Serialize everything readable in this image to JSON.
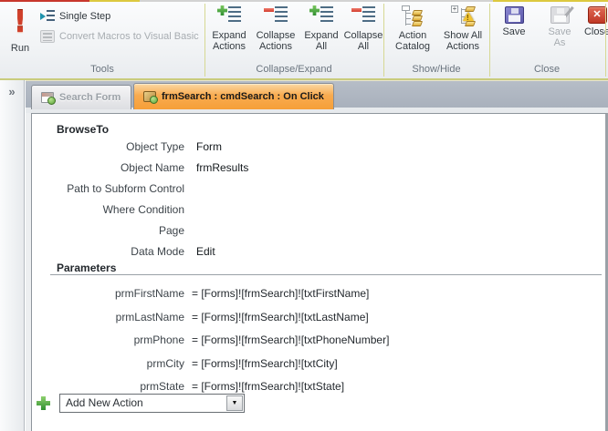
{
  "ribbon": {
    "groups": [
      {
        "label": "Tools",
        "buttons": [
          {
            "label": "Run"
          },
          {
            "label": "Single Step"
          },
          {
            "label": "Convert Macros to Visual Basic"
          }
        ]
      },
      {
        "label": "Collapse/Expand",
        "buttons": [
          {
            "label": "Expand Actions"
          },
          {
            "label": "Collapse Actions"
          },
          {
            "label": "Expand All"
          },
          {
            "label": "Collapse All"
          }
        ]
      },
      {
        "label": "Show/Hide",
        "buttons": [
          {
            "label": "Action Catalog"
          },
          {
            "label": "Show All Actions"
          }
        ]
      },
      {
        "label": "Close",
        "buttons": [
          {
            "label": "Save"
          },
          {
            "label": "Save As"
          },
          {
            "label": "Close"
          }
        ]
      }
    ]
  },
  "nav_pane": {
    "expand_chevron": "»"
  },
  "tabs": [
    {
      "label": "Search Form",
      "active": false
    },
    {
      "label": "frmSearch : cmdSearch : On Click",
      "active": true
    }
  ],
  "macro": {
    "action": "BrowseTo",
    "fields": [
      {
        "label": "Object Type",
        "value": "Form"
      },
      {
        "label": "Object Name",
        "value": "frmResults"
      },
      {
        "label": "Path to Subform Control",
        "value": ""
      },
      {
        "label": "Where Condition",
        "value": ""
      },
      {
        "label": "Page",
        "value": ""
      },
      {
        "label": "Data Mode",
        "value": "Edit"
      }
    ],
    "parameters_heading": "Parameters",
    "parameters": [
      {
        "name": "prmFirstName",
        "value": "= [Forms]![frmSearch]![txtFirstName]"
      },
      {
        "name": "prmLastName",
        "value": "= [Forms]![frmSearch]![txtLastName]"
      },
      {
        "name": "prmPhone",
        "value": "= [Forms]![frmSearch]![txtPhoneNumber]"
      },
      {
        "name": "prmCity",
        "value": "= [Forms]![frmSearch]![txtCity]"
      },
      {
        "name": "prmState",
        "value": "= [Forms]![frmSearch]![txtState]"
      }
    ],
    "add_new_action_placeholder": "Add New Action"
  },
  "icons": {
    "run_exclamation": "!",
    "close_x": "✕",
    "dropdown_arrow": "▼"
  },
  "colors": {
    "active_tab_orange": "#f7a243",
    "ribbon_contextual_border": "#c9cc7c",
    "save_purple": "#6a67b0",
    "close_red": "#cf4a3f",
    "expand_green": "#2f8f2f",
    "collapse_red": "#d23b2c"
  }
}
